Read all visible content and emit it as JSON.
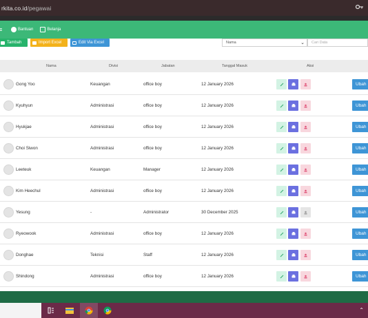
{
  "browser": {
    "url_domain": "rkita.co.id",
    "url_path": "/pegawai",
    "key_icon": "key-icon"
  },
  "navbar": {
    "items": [
      {
        "label": "Bantuan",
        "icon": "help-icon"
      },
      {
        "label": "Belanja",
        "icon": "cart-icon"
      }
    ]
  },
  "toolbar": {
    "tambah_label": "Tambah",
    "import_label": "Import Excel",
    "edit_excel_label": "Edit Via Excel",
    "filter_select_value": "Nama",
    "search_placeholder": "Cari Data"
  },
  "table": {
    "columns": [
      "Nama",
      "Divisi",
      "Jabatan",
      "Tanggal Masuk",
      "Aksi"
    ],
    "ubah_label": "Ubah",
    "rows": [
      {
        "nama": "Gong Yoo",
        "divisi": "Keuangan",
        "jabatan": "office boy",
        "tanggal": "12 January 2026",
        "delete_enabled": true
      },
      {
        "nama": "Kyuhyun",
        "divisi": "Administrasi",
        "jabatan": "office boy",
        "tanggal": "12 January 2026",
        "delete_enabled": true
      },
      {
        "nama": "Hyukjae",
        "divisi": "Administrasi",
        "jabatan": "office boy",
        "tanggal": "12 January 2026",
        "delete_enabled": true
      },
      {
        "nama": "Choi Siwon",
        "divisi": "Administrasi",
        "jabatan": "office boy",
        "tanggal": "12 January 2026",
        "delete_enabled": true
      },
      {
        "nama": "Leeteuk",
        "divisi": "Keuangan",
        "jabatan": "Manager",
        "tanggal": "12 January 2026",
        "delete_enabled": true
      },
      {
        "nama": "Kim Heechul",
        "divisi": "Administrasi",
        "jabatan": "office boy",
        "tanggal": "12 January 2026",
        "delete_enabled": true
      },
      {
        "nama": "Yesung",
        "divisi": "-",
        "jabatan": "Administrator",
        "tanggal": "30 December 2025",
        "delete_enabled": false
      },
      {
        "nama": "Ryeowook",
        "divisi": "Administrasi",
        "jabatan": "office boy",
        "tanggal": "12 January 2026",
        "delete_enabled": true
      },
      {
        "nama": "Donghae",
        "divisi": "Teknisi",
        "jabatan": "Staff",
        "tanggal": "12 January 2026",
        "delete_enabled": true
      },
      {
        "nama": "Shindong",
        "divisi": "Administrasi",
        "jabatan": "office boy",
        "tanggal": "12 January 2026",
        "delete_enabled": true
      }
    ]
  },
  "colors": {
    "navbar": "#3cb878",
    "tambah": "#27b36b",
    "import": "#f3b21b",
    "edit_excel": "#3e95d6",
    "ubah": "#3e95d6",
    "view_action": "#6b70e0",
    "taskbar": "#6b2a48"
  }
}
